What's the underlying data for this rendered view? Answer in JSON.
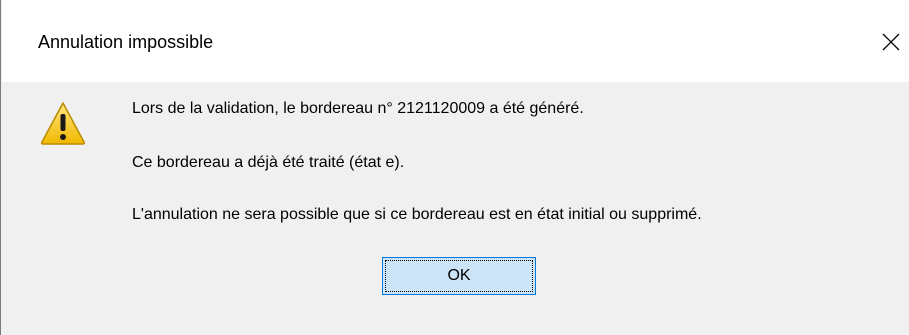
{
  "dialog": {
    "title": "Annulation impossible",
    "close_icon": "close-icon",
    "warning_icon": "warning-icon",
    "messages": [
      "Lors de la validation, le bordereau n° 2121120009 a été généré.",
      "Ce bordereau a déjà été traité (état e).",
      "L'annulation ne sera possible que si ce bordereau est en état initial ou supprimé."
    ],
    "ok_label": "OK"
  },
  "colors": {
    "titlebar_bg": "#ffffff",
    "body_bg": "#f0f0f0",
    "button_bg": "#cce4f7",
    "button_border": "#0078d7",
    "warning_yellow": "#f5c400"
  }
}
